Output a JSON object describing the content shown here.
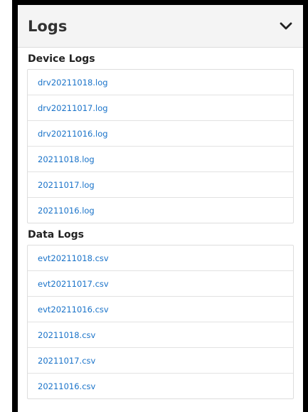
{
  "panel": {
    "title": "Logs",
    "toggle_icon": "chevron-down-icon"
  },
  "device_logs": {
    "title": "Device Logs",
    "files": [
      "drv20211018.log",
      "drv20211017.log",
      "drv20211016.log",
      "20211018.log",
      "20211017.log",
      "20211016.log"
    ]
  },
  "data_logs": {
    "title": "Data Logs",
    "files": [
      "evt20211018.csv",
      "evt20211017.csv",
      "evt20211016.csv",
      "20211018.csv",
      "20211017.csv",
      "20211016.csv"
    ]
  },
  "colors": {
    "link": "#1a73c9",
    "header_bg": "#f4f4f4",
    "border": "#000000"
  }
}
